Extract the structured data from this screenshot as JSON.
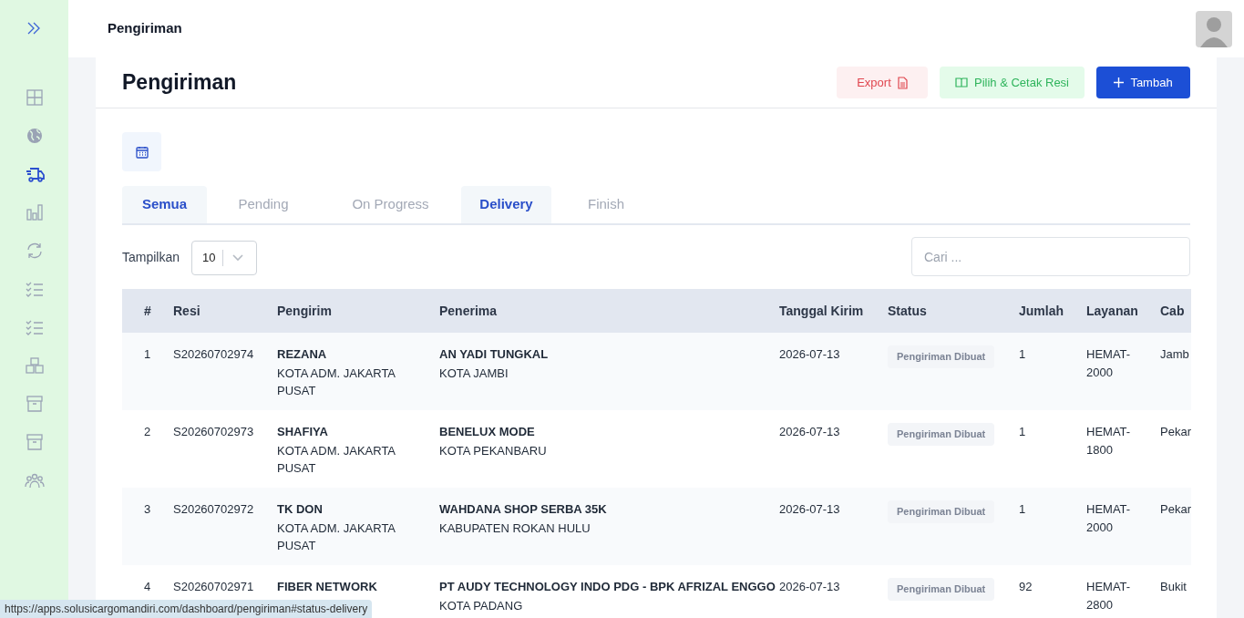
{
  "sidebar": {
    "items": [
      {
        "kind": "expand",
        "selected": false
      },
      {
        "kind": "grid",
        "selected": false
      },
      {
        "kind": "globe",
        "selected": false
      },
      {
        "kind": "truck",
        "selected": true
      },
      {
        "kind": "chart",
        "selected": false
      },
      {
        "kind": "sync",
        "selected": false
      },
      {
        "kind": "checklist",
        "selected": false
      },
      {
        "kind": "checklist",
        "selected": false
      },
      {
        "kind": "boxes",
        "selected": false
      },
      {
        "kind": "archive",
        "selected": false
      },
      {
        "kind": "archive",
        "selected": false
      },
      {
        "kind": "users",
        "selected": false
      }
    ]
  },
  "header": {
    "title": "Pengiriman"
  },
  "page": {
    "title": "Pengiriman",
    "buttons": [
      {
        "kind": "export",
        "label": "Export"
      },
      {
        "kind": "print",
        "label": "Pilih & Cetak Resi"
      },
      {
        "kind": "add",
        "label": "Tambah"
      }
    ]
  },
  "tabs": [
    {
      "label": "Semua",
      "selected": true
    },
    {
      "label": "Pending",
      "selected": false
    },
    {
      "label": "On Progress",
      "selected": false
    },
    {
      "label": "Delivery",
      "selected": true
    },
    {
      "label": "Finish",
      "selected": false
    }
  ],
  "page_size": {
    "label": "Tampilkan",
    "value": "10"
  },
  "search": {
    "placeholder": "Cari ..."
  },
  "table": {
    "columns": [
      "#",
      "Resi",
      "Pengirim",
      "Penerima",
      "Tanggal Kirim",
      "Status",
      "Jumlah",
      "Layanan",
      "Cab"
    ],
    "rows": [
      {
        "no": "1",
        "resi": "S20260702974",
        "sender": "REZANA",
        "sender_city": "KOTA ADM. JAKARTA PUSAT",
        "receiver": "AN YADI TUNGKAL",
        "receiver_city": "KOTA JAMBI",
        "date": "2026-07-13",
        "status": "Pengiriman Dibuat",
        "qty": "1",
        "service": "HEMAT-2000",
        "branch": "Jamb"
      },
      {
        "no": "2",
        "resi": "S20260702973",
        "sender": "SHAFIYA",
        "sender_city": "KOTA ADM. JAKARTA PUSAT",
        "receiver": "BENELUX MODE",
        "receiver_city": "KOTA PEKANBARU",
        "date": "2026-07-13",
        "status": "Pengiriman Dibuat",
        "qty": "1",
        "service": "HEMAT-1800",
        "branch": "Pekar"
      },
      {
        "no": "3",
        "resi": "S20260702972",
        "sender": "TK DON",
        "sender_city": "KOTA ADM. JAKARTA PUSAT",
        "receiver": "WAHDANA SHOP SERBA 35K",
        "receiver_city": "KABUPATEN ROKAN HULU",
        "date": "2026-07-13",
        "status": "Pengiriman Dibuat",
        "qty": "1",
        "service": "HEMAT-2000",
        "branch": "Pekar"
      },
      {
        "no": "4",
        "resi": "S20260702971",
        "sender": "FIBER NETWORK",
        "receiver": "PT AUDY TECHNOLOGY INDO PDG - BPK AFRIZAL ENGGO",
        "receiver_city": "KOTA PADANG",
        "date": "2026-07-13",
        "status": "Pengiriman Dibuat",
        "qty": "92",
        "service": "HEMAT-2800",
        "branch": "Bukit"
      }
    ]
  },
  "status_bar": {
    "url": "https://apps.solusicargomandiri.com/dashboard/pengiriman#status-delivery"
  }
}
